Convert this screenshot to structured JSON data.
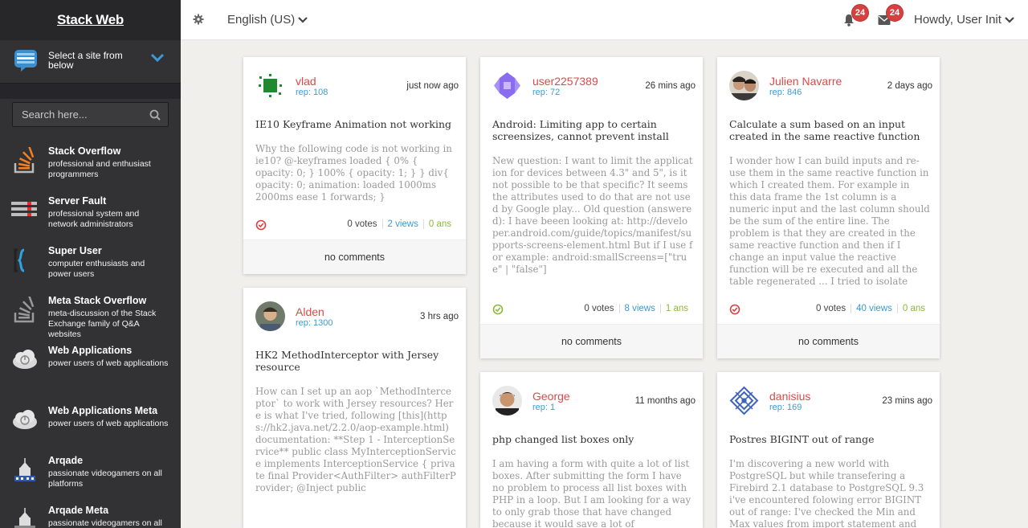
{
  "sidebar": {
    "brand": "Stack Web",
    "site_select": "Select a site from below",
    "search_placeholder": "Search here...",
    "sites": [
      {
        "name": "Stack Overflow",
        "desc": "professional and enthusiast programmers",
        "icon": "stackoverflow-icon"
      },
      {
        "name": "Server Fault",
        "desc": "professional system and network administrators",
        "icon": "serverfault-icon"
      },
      {
        "name": "Super User",
        "desc": "computer enthusiasts and power users",
        "icon": "superuser-icon"
      },
      {
        "name": "Meta Stack Overflow",
        "desc": "meta-discussion of the Stack Exchange family of Q&A websites",
        "icon": "meta-stackoverflow-icon"
      },
      {
        "name": "Web Applications",
        "desc": "power users of web applications",
        "icon": "webapps-icon"
      },
      {
        "name": "Web Applications Meta",
        "desc": "power users of web applications",
        "icon": "webapps-meta-icon"
      },
      {
        "name": "Arqade",
        "desc": "passionate videogamers on all platforms",
        "icon": "arqade-icon"
      },
      {
        "name": "Arqade Meta",
        "desc": "passionate videogamers on all platforms",
        "icon": "arqade-meta-icon"
      }
    ]
  },
  "topbar": {
    "language": "English (US)",
    "notifications_count": "24",
    "messages_count": "24",
    "greeting": "Howdy, User Init"
  },
  "colors": {
    "sidebar_bg": "#323235",
    "username": "#d94a4a",
    "rep": "#3b9ad6",
    "badge": "#d64040",
    "answers": "#8cb83a"
  },
  "cards": [
    {
      "user": "vlad",
      "rep": "rep: 108",
      "time": "just now ago",
      "title": "IE10 Keyframe Animation not working",
      "body": "Why the following code is not working in ie10? @-keyframes loaded { 0% { opacity: 0; } 100% { opacity: 1; } } div{ opacity: 0; animation: loaded 1000ms 2000ms ease 1 forwards; }",
      "status": "unanswered",
      "votes": "0 votes",
      "views": "2 views",
      "answers": "0 ans",
      "comments": "no comments"
    },
    {
      "user": "user2257389",
      "rep": "rep: 72",
      "time": "26 mins ago",
      "title": "Android: Limiting app to certain screensizes, cannot prevent install",
      "body": "New question: I want to limit the application for devices between 4.3\" and 5\", is it not possible to be that specific? It seems the attributes used to do that are not used by Google play... Old question (answered): I have beeen looking at: http://developer.android.com/guide/topics/manifest/supports-screens-element.html But if I use for example: android:smallScreens=[\"true\" | \"false\"]",
      "status": "answered",
      "votes": "0 votes",
      "views": "8 views",
      "answers": "1 ans",
      "comments": "no comments"
    },
    {
      "user": "Julien Navarre",
      "rep": "rep: 846",
      "time": "2 days ago",
      "title": "Calculate a sum based on an input created in the same reactive function",
      "body": "I wonder how I can build inputs and re-use them in the same reactive function in which I created them. For example in this data frame the 1st column is a numeric input and the last column should be the sum of the entire line. The problem is that they are created in the same reactive function and then if I change an input value the reactive function will be re executed and all the table regenerated ... I tried to isolate",
      "status": "unanswered",
      "votes": "0 votes",
      "views": "40 views",
      "answers": "0 ans",
      "comments": "no comments"
    },
    {
      "user": "Alden",
      "rep": "rep: 1300",
      "time": "3 hrs ago",
      "title": "HK2 MethodInterceptor with Jersey resource",
      "body": "How can I set up an aop `MethodInterceptor` to work with Jersey resources? Here is what I've tried, following [this](https://hk2.java.net/2.2.0/aop-example.html) documentation: **Step 1 - InterceptionService** public class MyInterceptionService implements InterceptionService { private final Provider<AuthFilter> authFilterProvider; @Inject public"
    },
    {
      "user": "George",
      "rep": "rep: 1",
      "time": "11 months ago",
      "title": "php changed list boxes only",
      "body": "I am having a form with quite a lot of list boxes. After submitting the form I have no problem to process all list boxes with PHP in a loop. But I am looking for a way to only grab those that have changed because it would save a lot of"
    },
    {
      "user": "danisius",
      "rep": "rep: 169",
      "time": "23 mins ago",
      "title": "Postres BIGINT out of range",
      "body": "I'm discovering a new world with PostgreSQL but while transefering a Firebird 2.1 database to PostgreSQL 9.3 i've encountered folowing error BIGINT out of range: I've checked the Min and Max values from import statement and"
    }
  ]
}
